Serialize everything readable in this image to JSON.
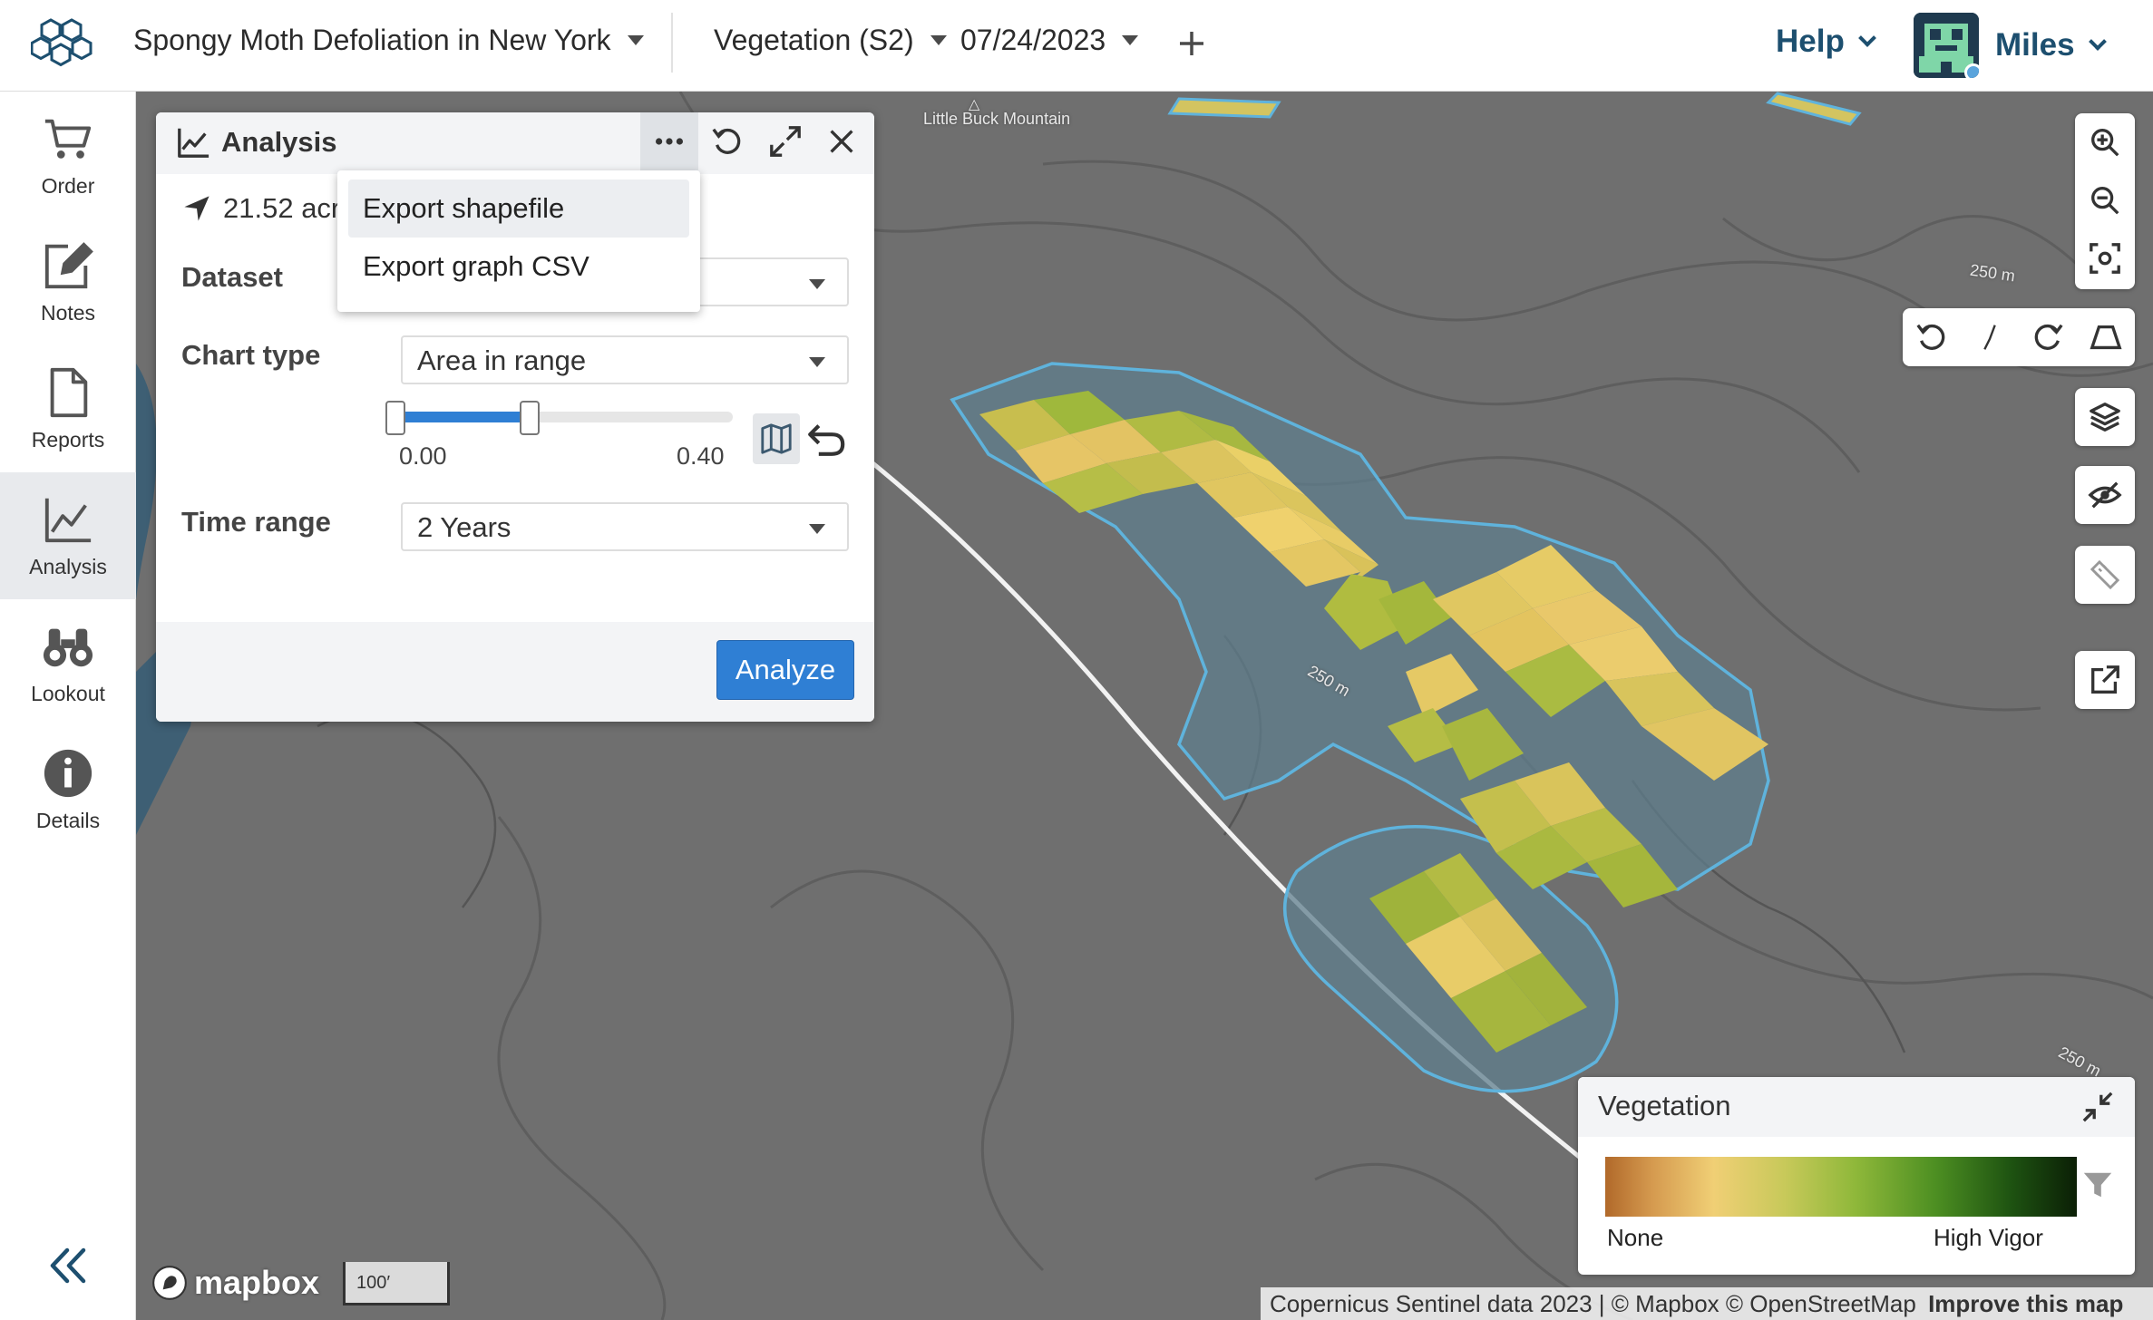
{
  "header": {
    "project_title": "Spongy Moth Defoliation in New York",
    "layer_label": "Vegetation (S2)",
    "date_label": "07/24/2023",
    "add_icon": "plus-icon",
    "help_label": "Help",
    "user_name": "Miles"
  },
  "sidebar": {
    "items": [
      {
        "label": "Order",
        "icon": "cart-icon"
      },
      {
        "label": "Notes",
        "icon": "note-edit-icon"
      },
      {
        "label": "Reports",
        "icon": "document-icon"
      },
      {
        "label": "Analysis",
        "icon": "line-chart-icon",
        "active": true
      },
      {
        "label": "Lookout",
        "icon": "binoculars-icon"
      },
      {
        "label": "Details",
        "icon": "info-icon"
      }
    ],
    "collapse_icon": "double-chevron-left-icon"
  },
  "panel": {
    "title": "Analysis",
    "acres": "21.52 acres",
    "acres_visible": "21.52 acre",
    "dataset_label": "Dataset",
    "chart_type_label": "Chart type",
    "chart_type_value": "Area in range",
    "range_min": "0.00",
    "range_max": "0.40",
    "range_low_fraction": 0.0,
    "range_high_fraction": 0.4,
    "time_range_label": "Time range",
    "time_range_value": "2 Years",
    "analyze_label": "Analyze"
  },
  "menu": {
    "items": [
      {
        "label": "Export shapefile",
        "highlighted": true
      },
      {
        "label": "Export graph CSV",
        "highlighted": false
      }
    ]
  },
  "map": {
    "place_label": "Little Buck Mountain",
    "contour_labels": [
      "250 m",
      "250 m",
      "250 m"
    ],
    "scale_label": "100′",
    "attribution": "Copernicus Sentinel data 2023 | © Mapbox © OpenStreetMap",
    "improve_link": "Improve this map",
    "mapbox_logo": "mapbox"
  },
  "legend": {
    "title": "Vegetation",
    "min_label": "None",
    "max_label": "High Vigor",
    "colors": [
      "#b1692a",
      "#f0cf75",
      "#8fb83a",
      "#1e5311",
      "#0b1f06"
    ]
  },
  "colors": {
    "accent": "#2f7fd4",
    "brand_text": "#1d4f6f",
    "aoi_outline": "#5fb3dc"
  }
}
